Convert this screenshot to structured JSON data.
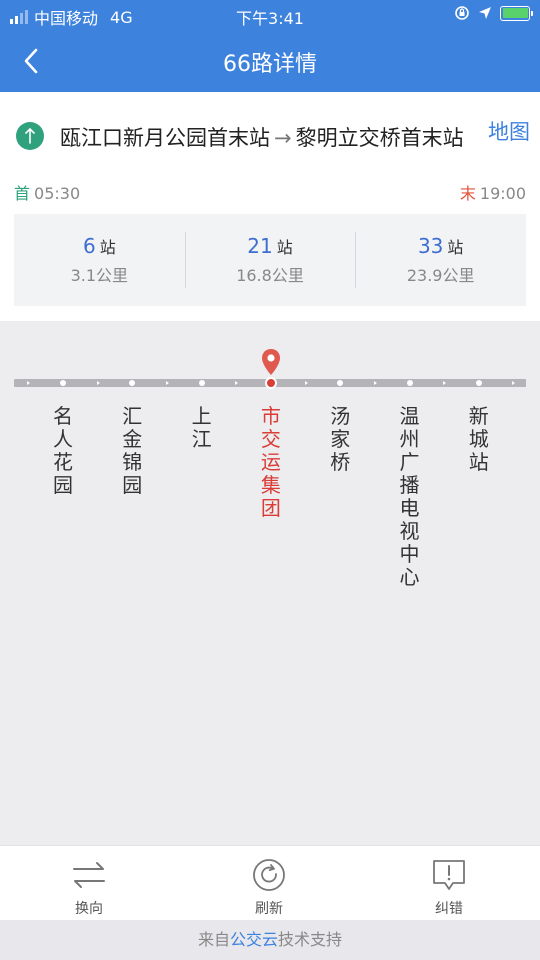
{
  "status": {
    "carrier": "中国移动",
    "network": "4G",
    "time": "下午3:41"
  },
  "nav": {
    "title": "66路详情"
  },
  "route": {
    "from": "瓯江口新月公园首末站",
    "arrow": "→",
    "to": "黎明立交桥首末站",
    "map_label": "地图",
    "first_tag": "首",
    "first_time": "05:30",
    "last_tag": "末",
    "last_time": "19:00"
  },
  "stats": [
    {
      "count": "6",
      "unit": "站",
      "distance": "3.1公里"
    },
    {
      "count": "21",
      "unit": "站",
      "distance": "16.8公里"
    },
    {
      "count": "33",
      "unit": "站",
      "distance": "23.9公里"
    }
  ],
  "stops": [
    "名人花园",
    "汇金锦园",
    "上江",
    "市交运集团",
    "汤家桥",
    "温州广播电视中心",
    "新城站"
  ],
  "current_stop_index": 3,
  "actions": {
    "switch": "换向",
    "refresh": "刷新",
    "report": "纠错"
  },
  "footer": {
    "prefix": "来自",
    "brand": "公交云",
    "suffix": "技术支持"
  },
  "colors": {
    "primary": "#3d82dd",
    "current": "#d93d36",
    "route_icon": "#2fa17d"
  }
}
